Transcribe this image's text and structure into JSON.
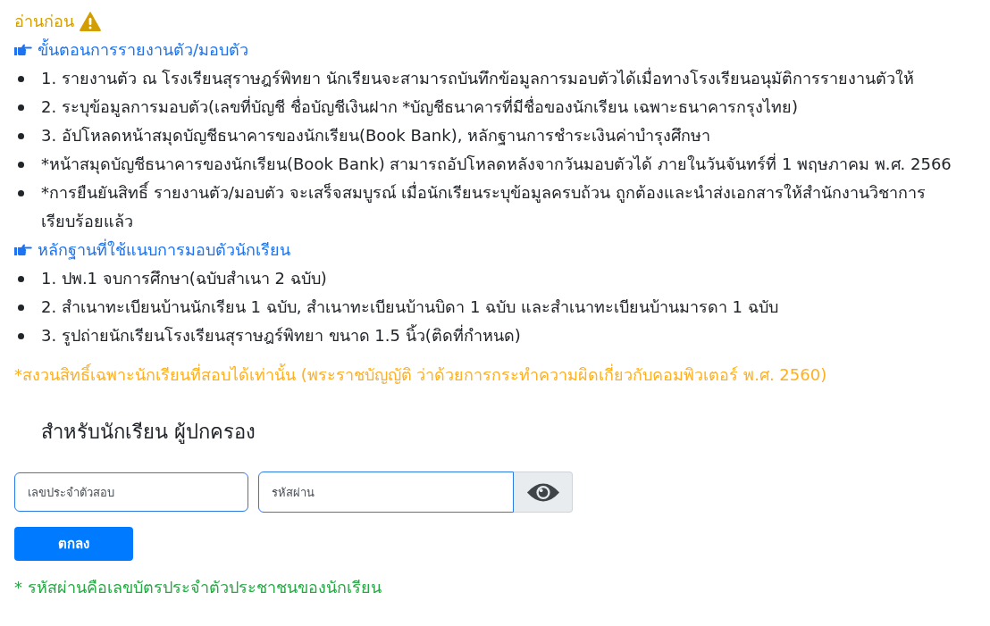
{
  "notice_title": "อ่านก่อน",
  "sections": [
    {
      "heading": "ขั้นตอนการรายงานตัว/มอบตัว",
      "items": [
        "1. รายงานตัว ณ โรงเรียนสุราษฎร์พิทยา นักเรียนจะสามารถบันทึกข้อมูลการมอบตัวได้เมื่อทางโรงเรียนอนุมัติการรายงานตัวให้",
        "2. ระบุข้อมูลการมอบตัว(เลขที่บัญชี ชื่อบัญชีเงินฝาก *บัญชีธนาคารที่มีชื่อของนักเรียน เฉพาะธนาคารกรุงไทย)",
        "3. อัปโหลดหน้าสมุดบัญชีธนาคารของนักเรียน(Book Bank), หลักฐานการชำระเงินค่าบำรุงศึกษา",
        "*หน้าสมุดบัญชีธนาคารของนักเรียน(Book Bank) สามารถอัปโหลดหลังจากวันมอบตัวได้ ภายในวันจันทร์ที่ 1 พฤษภาคม พ.ศ. 2566",
        "*การยืนยันสิทธิ์ รายงานตัว/มอบตัว จะเสร็จสมบูรณ์ เมื่อนักเรียนระบุข้อมูลครบถ้วน ถูกต้องและนำส่งเอกสารให้สำนักงานวิชาการเรียบร้อยแล้ว"
      ]
    },
    {
      "heading": "หลักฐานที่ใช้แนบการมอบตัวนักเรียน",
      "items": [
        "1. ปพ.1 จบการศึกษา(ฉบับสำเนา 2 ฉบับ)",
        "2. สำเนาทะเบียนบ้านนักเรียน 1 ฉบับ, สำเนาทะเบียนบ้านบิดา 1 ฉบับ และสำเนาทะเบียนบ้านมารดา 1 ฉบับ",
        "3. รูปถ่ายนักเรียนโรงเรียนสุราษฎร์พิทยา ขนาด 1.5 นิ้ว(ติดที่กำหนด)"
      ]
    }
  ],
  "legal_notice": "*สงวนสิทธิ์เฉพาะนักเรียนที่สอบได้เท่านั้น (พระราชบัญญัติ ว่าด้วยการกระทำความผิดเกี่ยวกับคอมพิวเตอร์ พ.ศ. 2560)",
  "login": {
    "title": "สำหรับนักเรียน ผู้ปกครอง",
    "exam_id": {
      "placeholder": "เลขประจำตัวสอบ"
    },
    "password": {
      "placeholder": "รหัสผ่าน"
    },
    "submit": "ตกลง",
    "note": "* รหัสผ่านคือเลขบัตรประจำตัวประชาชนของนักเรียน"
  }
}
